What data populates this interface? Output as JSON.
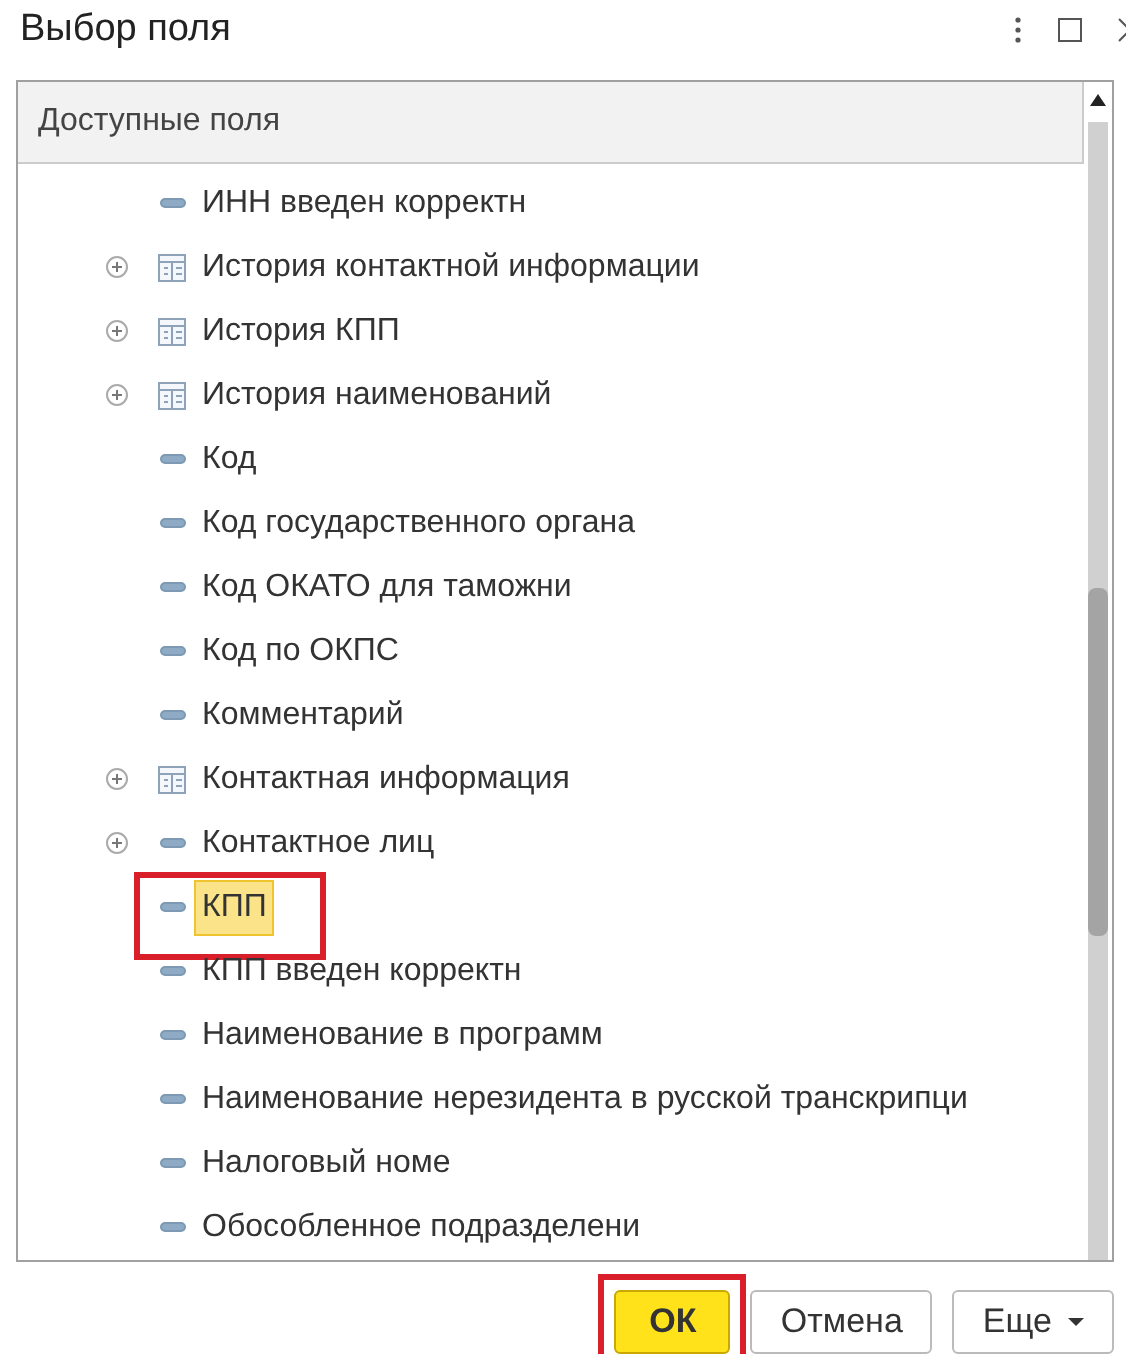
{
  "window": {
    "title": "Выбор поля"
  },
  "tree": {
    "header": "Доступные поля",
    "items": [
      {
        "label": "ИНН введен корректн",
        "kind": "field",
        "expandable": false,
        "selected": false,
        "callout": false
      },
      {
        "label": "История контактной информации",
        "kind": "table",
        "expandable": true,
        "selected": false,
        "callout": false
      },
      {
        "label": "История КПП",
        "kind": "table",
        "expandable": true,
        "selected": false,
        "callout": false
      },
      {
        "label": "История наименований",
        "kind": "table",
        "expandable": true,
        "selected": false,
        "callout": false
      },
      {
        "label": "Код",
        "kind": "field",
        "expandable": false,
        "selected": false,
        "callout": false
      },
      {
        "label": "Код государственного органа",
        "kind": "field",
        "expandable": false,
        "selected": false,
        "callout": false
      },
      {
        "label": "Код ОКАТО для таможни",
        "kind": "field",
        "expandable": false,
        "selected": false,
        "callout": false
      },
      {
        "label": "Код по ОКПС",
        "kind": "field",
        "expandable": false,
        "selected": false,
        "callout": false
      },
      {
        "label": "Комментарий",
        "kind": "field",
        "expandable": false,
        "selected": false,
        "callout": false
      },
      {
        "label": "Контактная информация",
        "kind": "table",
        "expandable": true,
        "selected": false,
        "callout": false
      },
      {
        "label": "Контактное лиц",
        "kind": "field",
        "expandable": true,
        "selected": false,
        "callout": false
      },
      {
        "label": "КПП",
        "kind": "field",
        "expandable": false,
        "selected": true,
        "callout": true
      },
      {
        "label": "КПП введен корректн",
        "kind": "field",
        "expandable": false,
        "selected": false,
        "callout": false
      },
      {
        "label": "Наименование в программ",
        "kind": "field",
        "expandable": false,
        "selected": false,
        "callout": false
      },
      {
        "label": "Наименование нерезидента в русской транскрипци",
        "kind": "field",
        "expandable": false,
        "selected": false,
        "callout": false
      },
      {
        "label": "Налоговый номе",
        "kind": "field",
        "expandable": false,
        "selected": false,
        "callout": false
      },
      {
        "label": "Обособленное подразделени",
        "kind": "field",
        "expandable": false,
        "selected": false,
        "callout": false
      }
    ]
  },
  "buttons": [
    {
      "label": "ОК",
      "kind": "primary",
      "callout": true
    },
    {
      "label": "Отмена",
      "kind": "plain",
      "callout": false
    },
    {
      "label": "Еще",
      "kind": "menu",
      "callout": false
    }
  ]
}
